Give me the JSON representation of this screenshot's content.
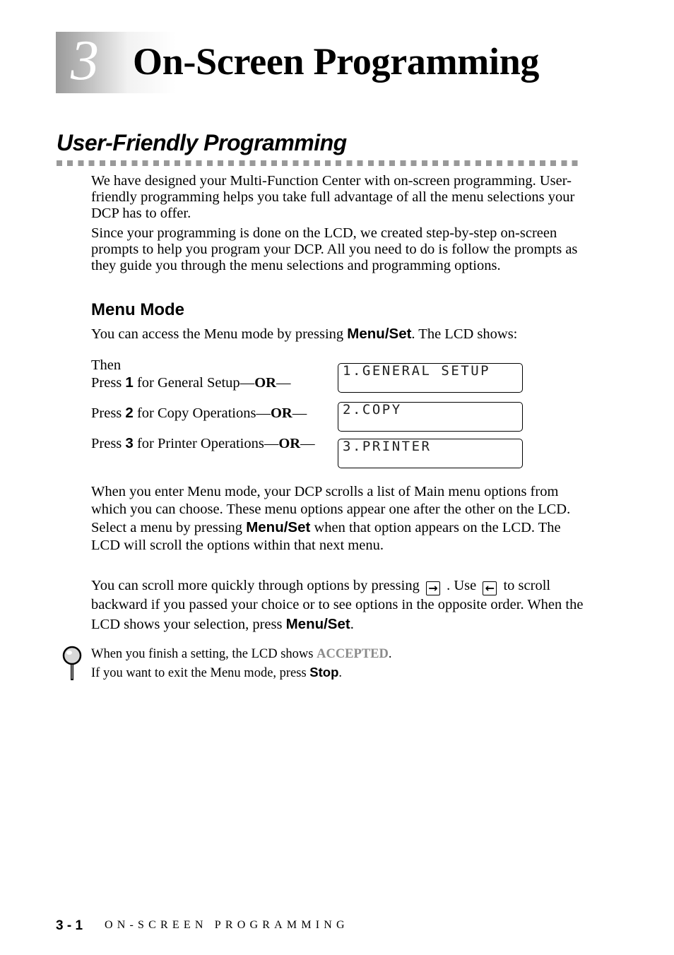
{
  "chapter": {
    "number": "3",
    "title": "On-Screen Programming"
  },
  "section": {
    "title": "User-Friendly Programming"
  },
  "intro": {
    "p1": "We have designed your Multi-Function Center with on-screen programming. User-friendly programming helps you take full advantage of all the menu selections your DCP has to offer.",
    "p2": "Since your programming is done on the LCD, we created step-by-step on-screen prompts to help you program your DCP. All you need to do is follow the prompts as they guide you through the menu selections and programming options."
  },
  "menu_mode": {
    "title": "Menu Mode",
    "access_pre": "You can access the Menu mode by pressing ",
    "access_key": "Menu/Set",
    "access_post": ". The LCD shows:",
    "then": "Then",
    "options": [
      {
        "pre": "Press ",
        "key": "1",
        "post": " for General Setup—",
        "or": "OR",
        "end": "—",
        "lcd": "1.GENERAL SETUP"
      },
      {
        "pre": "Press ",
        "key": "2",
        "post": " for Copy Operations—",
        "or": "OR",
        "end": "—",
        "lcd": "2.COPY"
      },
      {
        "pre": "Press ",
        "key": "3",
        "post": " for Printer Operations—",
        "or": "OR",
        "end": "—",
        "lcd": "3.PRINTER"
      }
    ],
    "scroll_p": {
      "pre": "When you enter Menu mode, your DCP scrolls a list of Main menu options from which you can choose. These menu options appear one after the other on the LCD. Select a menu by pressing ",
      "key": "Menu/Set",
      "post": " when that option appears on the LCD. The LCD will scroll the options within that next menu."
    },
    "quick_p": {
      "pre": "You can scroll more quickly through options by pressing ",
      "forward_icon": "right-arrow-key",
      "mid": " . Use ",
      "back_icon": "left-arrow-key",
      "post": " to scroll backward if you passed your choice or to see options in the opposite order. When the LCD shows your selection, press ",
      "key": "Menu/Set",
      "end": "."
    }
  },
  "note": {
    "icon": "magnifier-note-icon",
    "line1_pre": "When you finish a setting, the LCD shows ",
    "line1_key": "ACCEPTED",
    "line1_end": ".",
    "line2_pre": "If you want to exit the Menu mode, press ",
    "line2_key": "Stop",
    "line2_end": "."
  },
  "footer": {
    "page": "3 - 1",
    "title": "ON-SCREEN PROGRAMMING"
  }
}
